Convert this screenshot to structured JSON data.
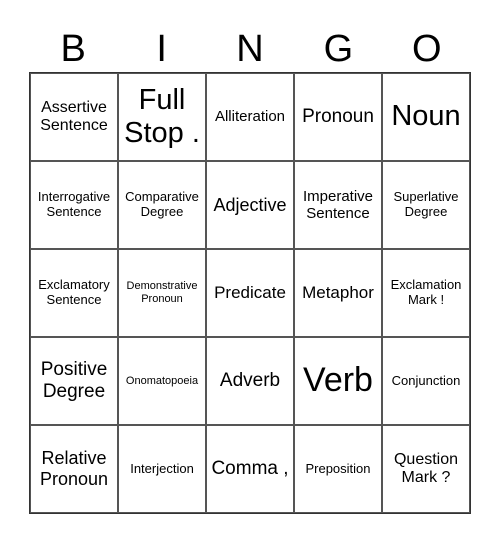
{
  "header": [
    "B",
    "I",
    "N",
    "G",
    "O"
  ],
  "cells": [
    [
      "Assertive Sentence",
      "Full Stop .",
      "Alliteration",
      "Pronoun",
      "Noun"
    ],
    [
      "Interrogative Sentence",
      "Comparative Degree",
      "Adjective",
      "Imperative Sentence",
      "Superlative Degree"
    ],
    [
      "Exclamatory Sentence",
      "Demonstrative Pronoun",
      "Predicate",
      "Metaphor",
      "Exclamation Mark !"
    ],
    [
      "Positive Degree",
      "Onomatopoeia",
      "Adverb",
      "Verb",
      "Conjunction"
    ],
    [
      "Relative Pronoun",
      "Interjection",
      "Comma ,",
      "Preposition",
      "Question Mark ?"
    ]
  ]
}
